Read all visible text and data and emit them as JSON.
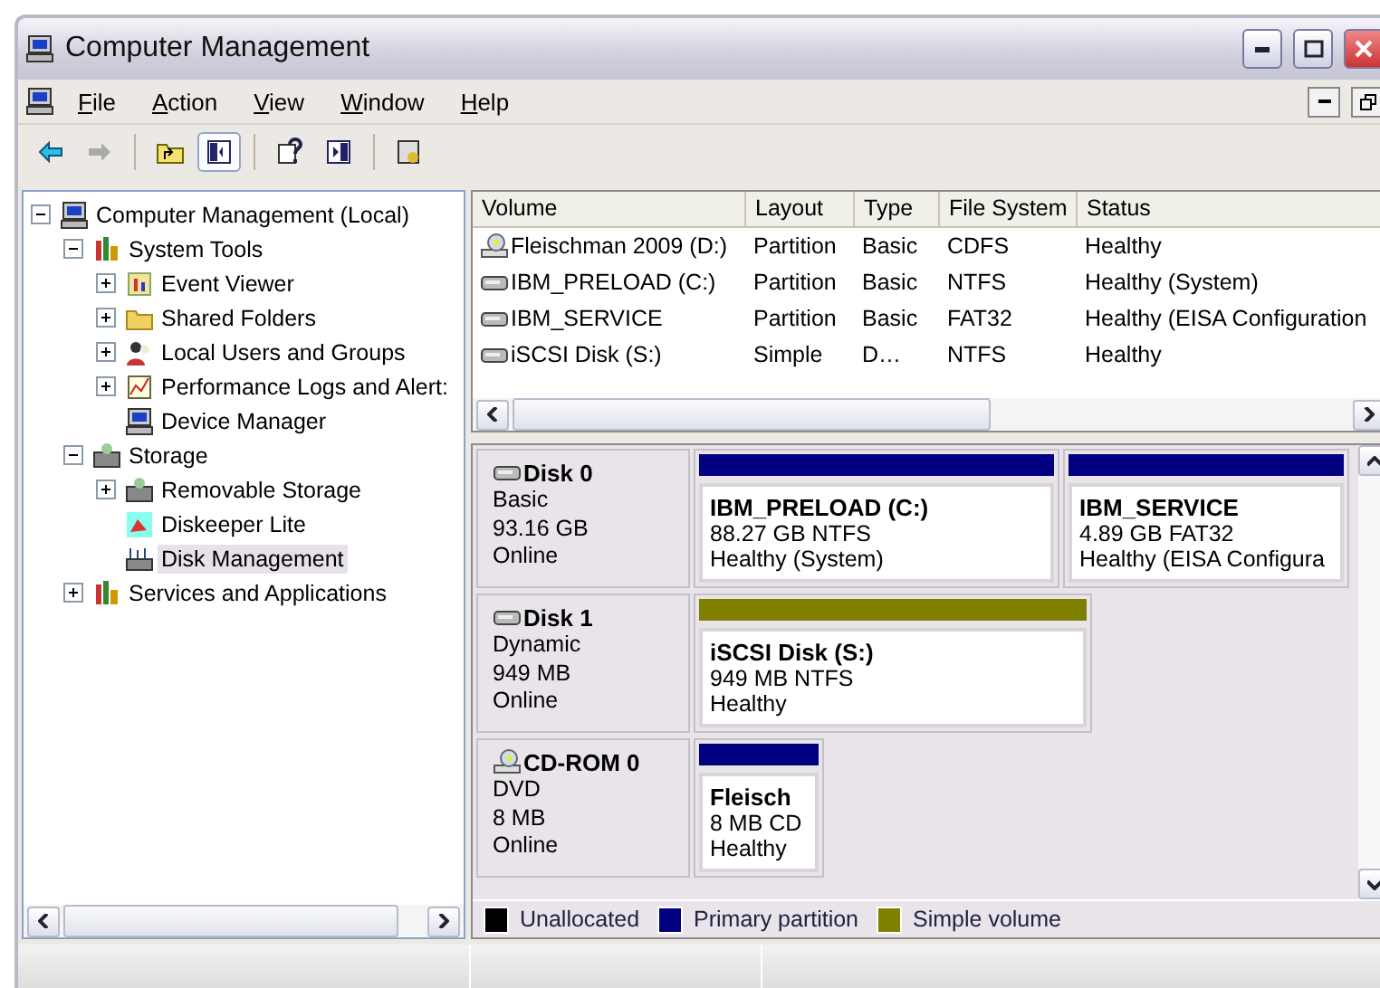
{
  "window": {
    "title": "Computer Management"
  },
  "menu": [
    "File",
    "Action",
    "View",
    "Window",
    "Help"
  ],
  "toolbar": [
    [
      {
        "kind": "back",
        "pressed": false
      },
      {
        "kind": "forward",
        "pressed": false
      }
    ],
    [
      {
        "kind": "up",
        "pressed": false
      },
      {
        "kind": "tree",
        "pressed": true
      }
    ],
    [
      {
        "kind": "help",
        "pressed": false
      },
      {
        "kind": "pane",
        "pressed": false
      }
    ],
    [
      {
        "kind": "props",
        "pressed": false
      }
    ]
  ],
  "tree": [
    {
      "label": "Computer Management (Local)",
      "kind": "computer",
      "selected": false,
      "expanded": true,
      "children": [
        {
          "label": "System Tools",
          "kind": "tools",
          "selected": false,
          "expanded": true,
          "children": [
            {
              "label": "Event Viewer",
              "kind": "log",
              "selected": false,
              "expanded": false
            },
            {
              "label": "Shared Folders",
              "kind": "folder",
              "selected": false,
              "expanded": false
            },
            {
              "label": "Local Users and Groups",
              "kind": "users",
              "selected": false,
              "expanded": false
            },
            {
              "label": "Performance Logs and Alert:",
              "kind": "chart",
              "selected": false,
              "expanded": false
            },
            {
              "label": "Device Manager",
              "kind": "computer",
              "selected": false
            }
          ]
        },
        {
          "label": "Storage",
          "kind": "storage",
          "selected": false,
          "expanded": true,
          "children": [
            {
              "label": "Removable Storage",
              "kind": "storage",
              "selected": false,
              "expanded": false
            },
            {
              "label": "Diskeeper Lite",
              "kind": "defrag",
              "selected": false
            },
            {
              "label": "Disk Management",
              "kind": "disk",
              "selected": true
            }
          ]
        },
        {
          "label": "Services and Applications",
          "kind": "tools",
          "selected": false,
          "expanded": false
        }
      ]
    }
  ],
  "volumes": {
    "columns": [
      "Volume",
      "Layout",
      "Type",
      "File System",
      "Status"
    ],
    "rows": [
      {
        "kind": "cd",
        "cells": [
          "Fleischman 2009 (D:)",
          "Partition",
          "Basic",
          "CDFS",
          "Healthy"
        ]
      },
      {
        "kind": "drive",
        "cells": [
          "IBM_PRELOAD (C:)",
          "Partition",
          "Basic",
          "NTFS",
          "Healthy (System)"
        ]
      },
      {
        "kind": "drive",
        "cells": [
          "IBM_SERVICE",
          "Partition",
          "Basic",
          "FAT32",
          "Healthy (EISA Configuration"
        ]
      },
      {
        "kind": "drive",
        "cells": [
          "iSCSI Disk (S:)",
          "Simple",
          "D…",
          "NTFS",
          "Healthy"
        ]
      }
    ]
  },
  "disks": [
    {
      "kind": "drive",
      "name": "Disk 0",
      "lines": [
        "Basic",
        "93.16 GB",
        "Online"
      ],
      "partitions": [
        {
          "kind": "primary",
          "name": "IBM_PRELOAD  (C:)",
          "size": "88.27 GB NTFS",
          "status": "Healthy (System)"
        },
        {
          "kind": "primary",
          "name": "IBM_SERVICE",
          "size": "4.89 GB FAT32",
          "status": "Healthy (EISA Configura"
        }
      ]
    },
    {
      "kind": "drive",
      "name": "Disk 1",
      "lines": [
        "Dynamic",
        "949 MB",
        "Online"
      ],
      "partitions": [
        {
          "kind": "simple",
          "name": "iSCSI Disk  (S:)",
          "size": "949 MB NTFS",
          "status": "Healthy"
        }
      ]
    },
    {
      "kind": "cd",
      "name": "CD-ROM 0",
      "lines": [
        "DVD",
        "8 MB",
        "Online"
      ],
      "partitions": [
        {
          "kind": "primary",
          "name": "Fleisch",
          "size": "8 MB CD",
          "status": "Healthy"
        }
      ]
    }
  ],
  "legend": [
    {
      "label": "Unallocated",
      "color": "#000000"
    },
    {
      "label": "Primary partition",
      "color": "#000080"
    },
    {
      "label": "Simple volume",
      "color": "#808000"
    }
  ]
}
